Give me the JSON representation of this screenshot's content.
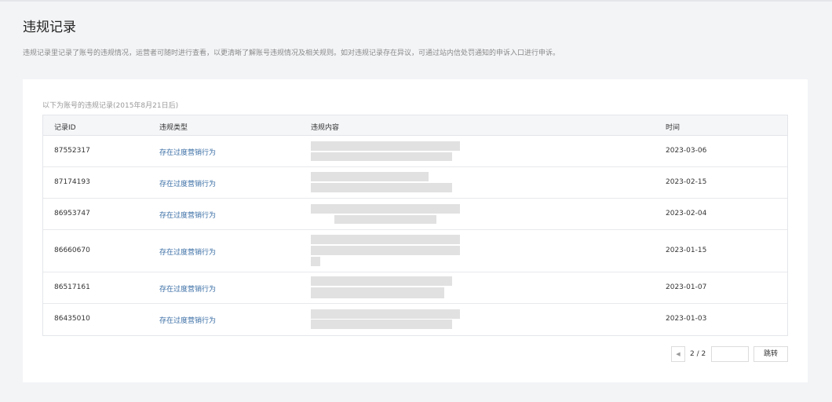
{
  "page": {
    "title": "违规记录",
    "description": "违规记录里记录了账号的违规情况，运营者可随时进行查看，以更清晰了解账号违规情况及相关规则。如对违规记录存在异议，可通过站内信处罚通知的申诉入口进行申诉。"
  },
  "table": {
    "caption": "以下为账号的违规记录(2015年8月21日后)",
    "headers": {
      "id": "记录ID",
      "type": "违规类型",
      "content": "违规内容",
      "time": "时间"
    },
    "rows": [
      {
        "id": "87552317",
        "type": "存在过度营销行为",
        "time": "2023-03-06"
      },
      {
        "id": "87174193",
        "type": "存在过度营销行为",
        "time": "2023-02-15"
      },
      {
        "id": "86953747",
        "type": "存在过度营销行为",
        "time": "2023-02-04"
      },
      {
        "id": "86660670",
        "type": "存在过度营销行为",
        "time": "2023-01-15"
      },
      {
        "id": "86517161",
        "type": "存在过度营销行为",
        "time": "2023-01-07"
      },
      {
        "id": "86435010",
        "type": "存在过度营销行为",
        "time": "2023-01-03"
      }
    ]
  },
  "pagination": {
    "prev_icon": "caret-left-icon",
    "page_info": "2 / 2",
    "input_value": "",
    "jump_label": "跳转"
  }
}
